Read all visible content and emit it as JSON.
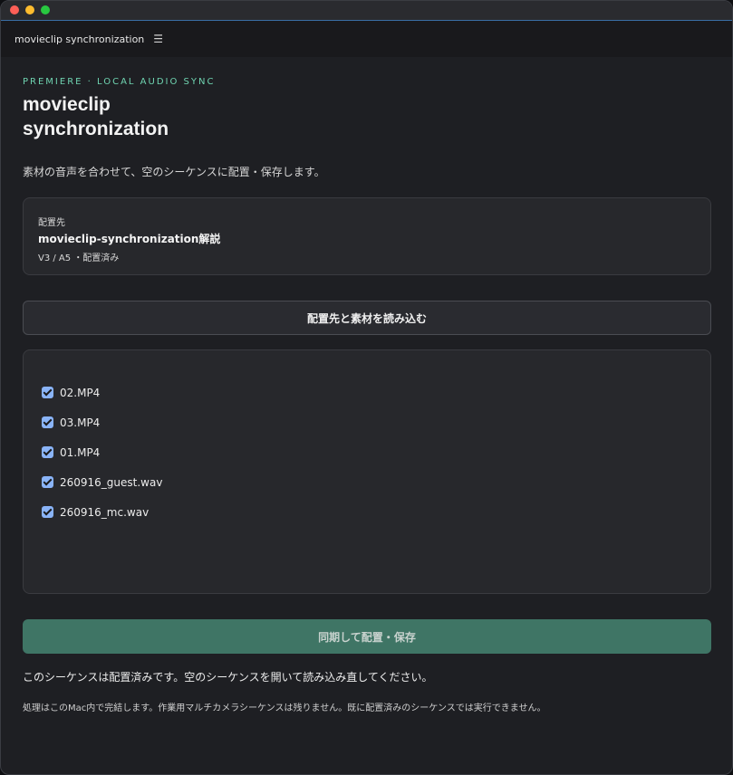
{
  "app": {
    "title": "movieclip synchronization",
    "menu_icon": "hamburger-menu-icon"
  },
  "header": {
    "eyebrow": "PREMIERE · LOCAL AUDIO SYNC",
    "title": "movieclip synchronization",
    "subtitle": "素材の音声を合わせて、空のシーケンスに配置・保存します。"
  },
  "destination": {
    "label": "配置先",
    "name": "movieclip-synchronization解説",
    "meta": "V3 / A5 ・配置済み"
  },
  "actions": {
    "load_label": "配置先と素材を読み込む",
    "sync_label": "同期して配置・保存"
  },
  "files": [
    {
      "name": "02.MP4",
      "checked": true
    },
    {
      "name": "03.MP4",
      "checked": true
    },
    {
      "name": "01.MP4",
      "checked": true
    },
    {
      "name": "260916_guest.wav",
      "checked": true
    },
    {
      "name": "260916_mc.wav",
      "checked": true
    }
  ],
  "status": {
    "message": "このシーケンスは配置済みです。空のシーケンスを開いて読み込み直してください。",
    "footnote": "処理はこのMac内で完結します。作業用マルチカメラシーケンスは残りません。既に配置済みのシーケンスでは実行できません。"
  },
  "colors": {
    "accent": "#6fd3b0",
    "sync_button": "#3f7565",
    "checkbox": "#8ab4f8"
  }
}
